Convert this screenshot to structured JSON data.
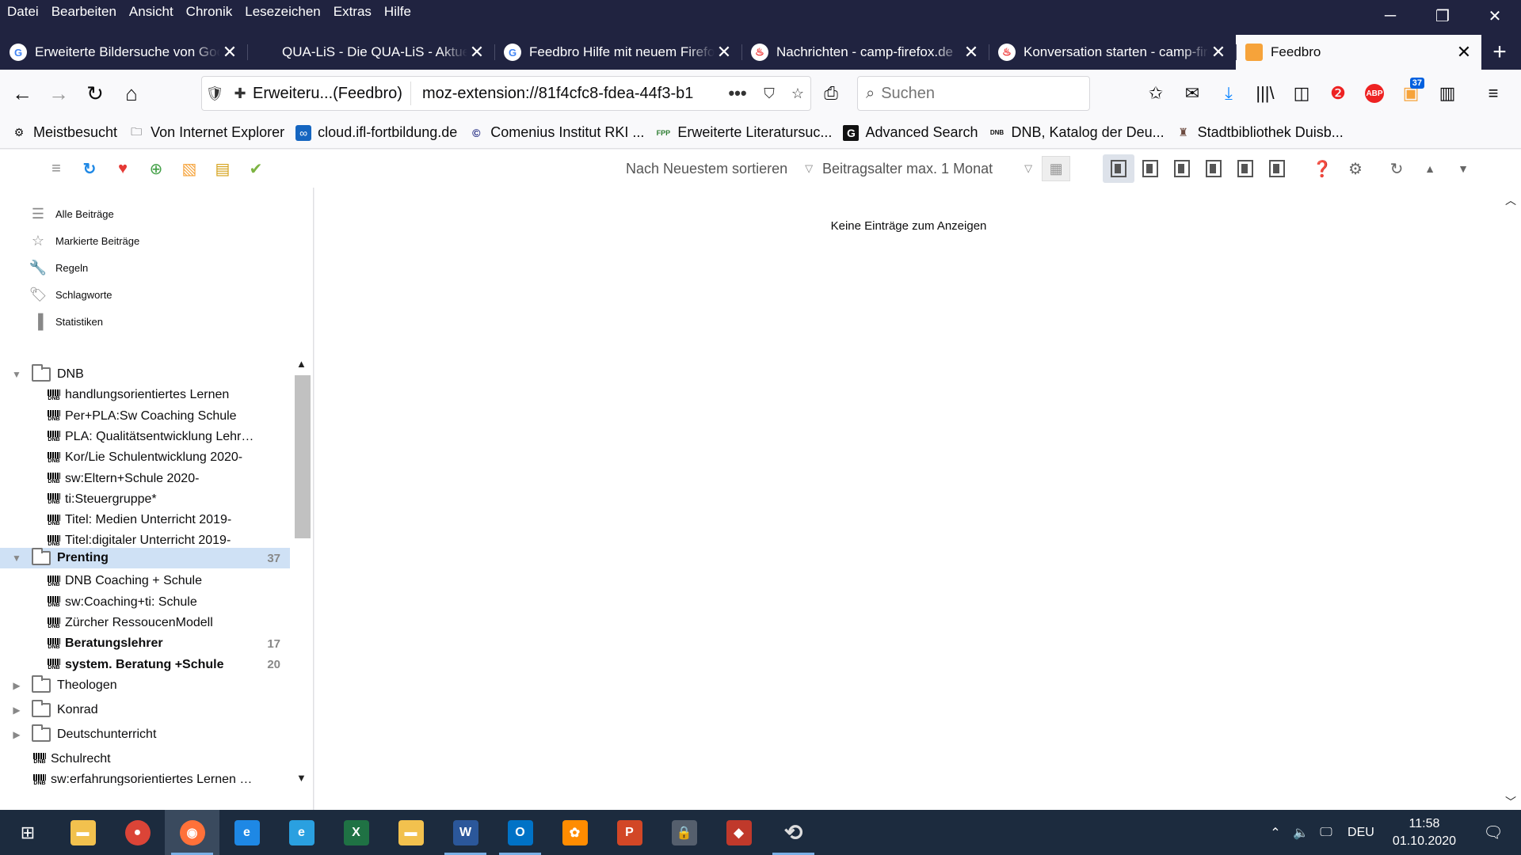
{
  "menubar": [
    "Datei",
    "Bearbeiten",
    "Ansicht",
    "Chronik",
    "Lesezeichen",
    "Extras",
    "Hilfe"
  ],
  "window_controls": {
    "minimize": "─",
    "restore": "❐",
    "close": "✕"
  },
  "tabs": [
    {
      "label": "Erweiterte Bildersuche von Google",
      "icon": "google-icon"
    },
    {
      "label": "QUA-LiS - Die QUA-LiS - Aktuelles",
      "icon": "qualis-icon"
    },
    {
      "label": "Feedbro Hilfe mit neuem Firefox",
      "icon": "google-icon"
    },
    {
      "label": "Nachrichten - camp-firefox.de",
      "icon": "camp-firefox-icon"
    },
    {
      "label": "Konversation starten - camp-firefox",
      "icon": "camp-firefox-icon"
    },
    {
      "label": "Feedbro",
      "icon": "feedbro-icon",
      "active": true
    }
  ],
  "navbar": {
    "identity_label": "Erweiteru...(Feedbro)",
    "url": "moz-extension://81f4cfc8-fdea-44f3-b1",
    "search_placeholder": "Suchen",
    "downloads_badge": "37"
  },
  "bookmarks": [
    {
      "label": "Meistbesucht",
      "icon": "gear-icon"
    },
    {
      "label": "Von Internet Explorer",
      "icon": "folder-icon"
    },
    {
      "label": "cloud.ifl-fortbildung.de",
      "icon": "cloud-icon"
    },
    {
      "label": "Comenius Institut RKI ...",
      "icon": "comenius-icon"
    },
    {
      "label": "Erweiterte Literatursuc...",
      "icon": "fpp-icon"
    },
    {
      "label": "Advanced Search",
      "icon": "g-icon"
    },
    {
      "label": "DNB, Katalog der Deu...",
      "icon": "dnb-icon"
    },
    {
      "label": "Stadtbibliothek Duisb...",
      "icon": "library-icon"
    }
  ],
  "feedbro_toolbar": {
    "sort_label": "Nach Neuestem sortieren",
    "age_label": "Beitragsalter max. 1 Monat"
  },
  "sidebar": {
    "nav": [
      {
        "label": "Alle Beiträge",
        "icon": "list-icon"
      },
      {
        "label": "Markierte Beiträge",
        "icon": "star-icon"
      },
      {
        "label": "Regeln",
        "icon": "wrench-icon"
      },
      {
        "label": "Schlagworte",
        "icon": "tag-icon"
      },
      {
        "label": "Statistiken",
        "icon": "chart-icon"
      }
    ],
    "tree": [
      {
        "type": "folder",
        "label": "DNB",
        "expanded": true,
        "count": ""
      },
      {
        "type": "feed",
        "label": "handlungsorientiertes Lernen",
        "count": ""
      },
      {
        "type": "feed",
        "label": "Per+PLA:Sw Coaching Schule",
        "count": ""
      },
      {
        "type": "feed",
        "label": "PLA: Qualitätsentwicklung Lehrerfortbildung",
        "count": ""
      },
      {
        "type": "feed",
        "label": "Kor/Lie Schulentwicklung 2020-",
        "count": ""
      },
      {
        "type": "feed",
        "label": "sw:Eltern+Schule 2020-",
        "count": ""
      },
      {
        "type": "feed",
        "label": "ti:Steuergruppe*",
        "count": ""
      },
      {
        "type": "feed",
        "label": "Titel: Medien Unterricht 2019-",
        "count": ""
      },
      {
        "type": "feed",
        "label": "Titel:digitaler Unterricht 2019-",
        "count": ""
      },
      {
        "type": "folder",
        "label": "Prenting",
        "expanded": true,
        "count": "37",
        "selected": true,
        "bold": true
      },
      {
        "type": "feed",
        "label": "DNB Coaching + Schule",
        "count": ""
      },
      {
        "type": "feed",
        "label": "sw:Coaching+ti: Schule",
        "count": ""
      },
      {
        "type": "feed",
        "label": "Zürcher RessoucenModell",
        "count": ""
      },
      {
        "type": "feed",
        "label": "Beratungslehrer",
        "count": "17",
        "bold": true
      },
      {
        "type": "feed",
        "label": "system. Beratung +Schule",
        "count": "20",
        "bold": true
      },
      {
        "type": "folder",
        "label": "Theologen",
        "expanded": false,
        "count": ""
      },
      {
        "type": "folder",
        "label": "Konrad",
        "expanded": false,
        "count": ""
      },
      {
        "type": "folder",
        "label": "Deutschunterricht",
        "expanded": false,
        "count": ""
      },
      {
        "type": "root-feed",
        "label": "Schulrecht",
        "count": ""
      },
      {
        "type": "root-feed",
        "label": "sw:erfahrungsorientiertes Lernen + Grundschule",
        "count": ""
      }
    ]
  },
  "content": {
    "empty_message": "Keine Einträge zum Anzeigen"
  },
  "taskbar": {
    "apps": [
      {
        "name": "file-explorer",
        "color": "#f2c14e"
      },
      {
        "name": "chrome",
        "color": "#db4437"
      },
      {
        "name": "firefox",
        "color": "#ff7139",
        "active": true
      },
      {
        "name": "edge",
        "color": "#1e88e5"
      },
      {
        "name": "internet-explorer",
        "color": "#2aa0e0"
      },
      {
        "name": "excel",
        "color": "#1f7244"
      },
      {
        "name": "file-explorer-2",
        "color": "#f2c14e"
      },
      {
        "name": "word",
        "color": "#2b579a"
      },
      {
        "name": "outlook",
        "color": "#0072c6"
      },
      {
        "name": "butterfly-app",
        "color": "#ff8c00"
      },
      {
        "name": "powerpoint",
        "color": "#d24726"
      },
      {
        "name": "password-app",
        "color": "#555f6d"
      },
      {
        "name": "cube-app",
        "color": "#c0392b"
      },
      {
        "name": "sync-app",
        "color": "#dddddd"
      }
    ],
    "language": "DEU",
    "time": "11:58",
    "date": "01.10.2020"
  }
}
